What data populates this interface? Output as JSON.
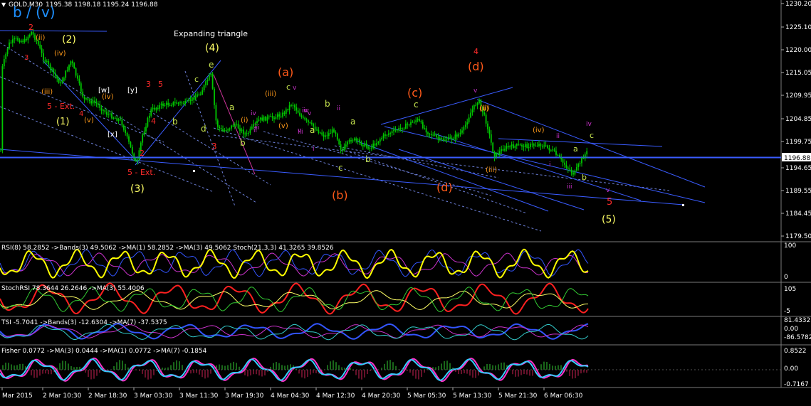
{
  "header": {
    "symbol": "GOLD,M30",
    "ohlc": "1195.38 1198.18 1195.24 1196.88",
    "wave_label": "b / (v)"
  },
  "main_price_axis": {
    "ticks": [
      "1230.20",
      "1225.10",
      "1220.00",
      "1215.05",
      "1209.95",
      "1204.85",
      "1199.75",
      "1194.65",
      "1189.55",
      "1184.45",
      "1179.50"
    ],
    "current_price": "1196.88"
  },
  "time_axis": {
    "ticks": [
      "Mar 2015",
      "2 Mar 10:30",
      "2 Mar 18:30",
      "3 Mar 03:30",
      "3 Mar 11:30",
      "3 Mar 19:30",
      "4 Mar 04:30",
      "4 Mar 12:30",
      "4 Mar 20:30",
      "5 Mar 05:30",
      "5 Mar 13:30",
      "5 Mar 21:30",
      "6 Mar 06:30"
    ]
  },
  "annotations": {
    "title_note": "Expanding triangle",
    "labels": [
      {
        "t": "2",
        "c": "#ff2b2b"
      },
      {
        "t": "(2)",
        "c": "#ffff66"
      },
      {
        "t": "(1)",
        "c": "#ffff66"
      },
      {
        "t": "(ii)",
        "c": "#ff9a1a"
      },
      {
        "t": "(iv)",
        "c": "#ff9a1a"
      },
      {
        "t": "(iii)",
        "c": "#ff9a1a"
      },
      {
        "t": "(v)",
        "c": "#ff9a1a"
      },
      {
        "t": "5 - Ext.",
        "c": "#ff2b2b"
      },
      {
        "t": "3",
        "c": "#ff2b2b"
      },
      {
        "t": "4",
        "c": "#ff2b2b"
      },
      {
        "t": "[w]",
        "c": "#ffffff"
      },
      {
        "t": "[y]",
        "c": "#ffffff"
      },
      {
        "t": "[x]",
        "c": "#ffffff"
      },
      {
        "t": "3",
        "c": "#ff2b2b"
      },
      {
        "t": "5",
        "c": "#ff2b2b"
      },
      {
        "t": "4",
        "c": "#ff2b2b"
      },
      {
        "t": "2",
        "c": "#ff2b2b"
      },
      {
        "t": "5 - Ext.",
        "c": "#ff2b2b"
      },
      {
        "t": "(3)",
        "c": "#ffff66"
      },
      {
        "t": "(4)",
        "c": "#ffff66"
      },
      {
        "t": "e",
        "c": "#c8e650"
      },
      {
        "t": "c",
        "c": "#c8e650"
      },
      {
        "t": "d",
        "c": "#c8e650"
      },
      {
        "t": "b",
        "c": "#c8e650"
      },
      {
        "t": "a",
        "c": "#c8e650"
      },
      {
        "t": "3",
        "c": "#ff2b2b"
      },
      {
        "t": "(a)",
        "c": "#ff5a1a"
      },
      {
        "t": "(b)",
        "c": "#ff5a1a"
      },
      {
        "t": "(c)",
        "c": "#ff5a1a"
      },
      {
        "t": "(d)",
        "c": "#ff5a1a"
      },
      {
        "t": "(d)",
        "c": "#ff5a1a"
      },
      {
        "t": "4",
        "c": "#ff2b2b"
      },
      {
        "t": "c",
        "c": "#c8e650"
      },
      {
        "t": "a",
        "c": "#c8e650"
      },
      {
        "t": "b",
        "c": "#c8e650"
      },
      {
        "t": "b",
        "c": "#c8e650"
      },
      {
        "t": "c",
        "c": "#c8e650"
      },
      {
        "t": "a",
        "c": "#c8e650"
      },
      {
        "t": "b",
        "c": "#c8e650"
      },
      {
        "t": "c",
        "c": "#c8e650"
      },
      {
        "t": "(iii)",
        "c": "#ff9a1a"
      },
      {
        "t": "(v)",
        "c": "#ff9a1a"
      },
      {
        "t": "(ii)",
        "c": "#ff9a1a"
      },
      {
        "t": "(iii)",
        "c": "#ff9a1a"
      },
      {
        "t": "(iv)",
        "c": "#ff9a1a"
      },
      {
        "t": "iv",
        "c": "#cc33cc"
      },
      {
        "t": "ii",
        "c": "#cc33cc"
      },
      {
        "t": "iii",
        "c": "#cc33cc"
      },
      {
        "t": "v",
        "c": "#cc33cc"
      },
      {
        "t": "i",
        "c": "#cc33cc"
      },
      {
        "t": "a",
        "c": "#c8e650"
      },
      {
        "t": "b",
        "c": "#c8e650"
      },
      {
        "t": "c",
        "c": "#c8e650"
      },
      {
        "t": "5",
        "c": "#ff2b2b"
      },
      {
        "t": "(5)",
        "c": "#ffff66"
      },
      {
        "t": "iv",
        "c": "#cc33cc"
      },
      {
        "t": "v",
        "c": "#cc33cc"
      },
      {
        "t": "ii",
        "c": "#cc33cc"
      },
      {
        "t": "iii",
        "c": "#cc33cc"
      },
      {
        "t": "v",
        "c": "#cc33cc"
      },
      {
        "t": "(i)",
        "c": "#ff9a1a"
      },
      {
        "t": "(iv)",
        "c": "#ff9a1a"
      },
      {
        "t": "iv",
        "c": "#cc33cc"
      },
      {
        "t": "ii",
        "c": "#cc33cc"
      },
      {
        "t": "i",
        "c": "#cc33cc"
      },
      {
        "t": "iii",
        "c": "#cc33cc"
      },
      {
        "t": "v",
        "c": "#cc33cc"
      },
      {
        "t": "v",
        "c": "#cc33cc"
      },
      {
        "t": "iv",
        "c": "#cc33cc"
      },
      {
        "t": "(ii)",
        "c": "#ff9a1a"
      }
    ]
  },
  "panels": {
    "rsi": {
      "legend": "RSI(8) 58.2852  ->Bands(3) 49.5062  ->MA(1) 58.2852  ->MA(3) 49.5062  Stoch(21,3,3) 41.3265 39.8526",
      "ticks": [
        "100",
        "0"
      ]
    },
    "stochrsi": {
      "legend": "StochRSI 78.3644 26.2646  ->MA(3) 55.4006",
      "ticks": [
        "105",
        "-5"
      ]
    },
    "tsi": {
      "legend": "TSI -5.7041  ->Bands(3) -12.6304  ->MA(7) -37.5375",
      "ticks": [
        "81.4332",
        "0.00",
        "-86.5782"
      ]
    },
    "fisher": {
      "legend": "Fisher 0.0772  ->MA(3) 0.0444  ->MA(1) 0.0772  ->MA(7) -0.1854",
      "ticks": [
        "0.8522",
        "0.00",
        "-0.7167"
      ]
    }
  },
  "colors": {
    "background": "#000000",
    "candles": "#00c800",
    "trendline": "#3a5cff",
    "axis_text": "#ffffff",
    "separator": "#7a7a7a"
  }
}
